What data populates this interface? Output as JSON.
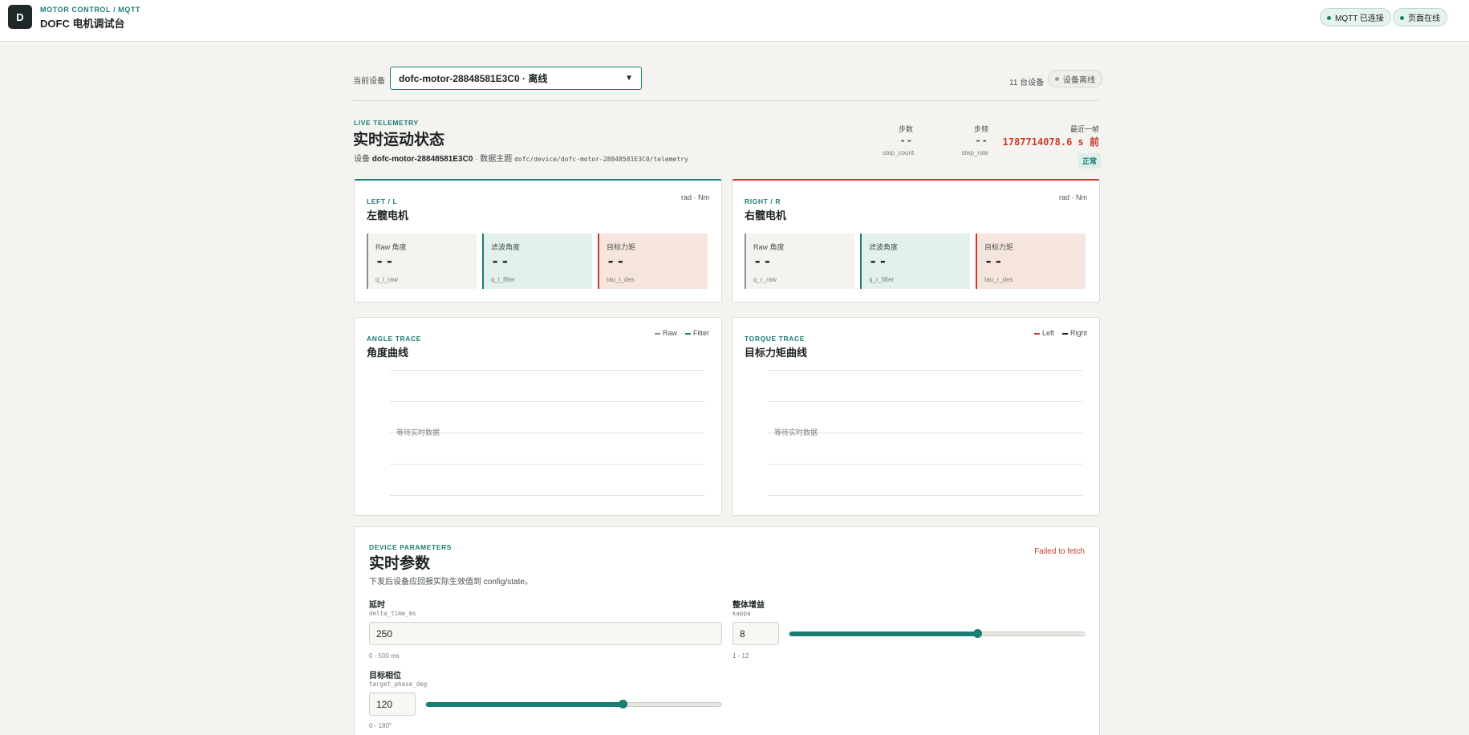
{
  "header": {
    "logo_letter": "D",
    "kicker": "MOTOR CONTROL / MQTT",
    "title": "DOFC 电机调试台",
    "mqtt_status": "MQTT 已连接",
    "page_status": "页面在线"
  },
  "device": {
    "label": "当前设备",
    "selected": "dofc-motor-28848581E3C0 · 离线",
    "count": "11 台设备",
    "state": "设备离线"
  },
  "telemetry": {
    "kicker": "LIVE TELEMETRY",
    "title": "实时运动状态",
    "device_prefix": "设备",
    "device_id": "dofc-motor-28848581E3C0",
    "topic_prefix": "· 数据主题",
    "topic": "dofc/device/dofc-motor-28848581E3C0/telemetry",
    "stats": {
      "steps": {
        "label": "步数",
        "value": "--",
        "key": "step_count"
      },
      "rate": {
        "label": "步频",
        "value": "--",
        "key": "step_rate"
      },
      "last_frame": {
        "label": "最近一帧",
        "value": "1787714078.6 s 前"
      }
    },
    "status": "正常"
  },
  "motors": {
    "left": {
      "kicker": "LEFT / L",
      "title": "左髋电机",
      "unit": "rad · Nm",
      "raw": {
        "label": "Raw 角度",
        "value": "--",
        "key": "q_l_raw"
      },
      "filter": {
        "label": "滤波角度",
        "value": "--",
        "key": "q_l_filter"
      },
      "torque": {
        "label": "目标力矩",
        "value": "--",
        "key": "tau_l_des"
      }
    },
    "right": {
      "kicker": "RIGHT / R",
      "title": "右髋电机",
      "unit": "rad · Nm",
      "raw": {
        "label": "Raw 角度",
        "value": "--",
        "key": "q_r_raw"
      },
      "filter": {
        "label": "滤波角度",
        "value": "--",
        "key": "q_r_filter"
      },
      "torque": {
        "label": "目标力矩",
        "value": "--",
        "key": "tau_r_des"
      }
    }
  },
  "charts": {
    "angle": {
      "kicker": "ANGLE TRACE",
      "title": "角度曲线",
      "legend": [
        "Raw",
        "Filter"
      ],
      "waiting": "等待实时数据"
    },
    "torque": {
      "kicker": "TORQUE TRACE",
      "title": "目标力矩曲线",
      "legend": [
        "Left",
        "Right"
      ],
      "waiting": "等待实时数据"
    }
  },
  "params": {
    "kicker": "DEVICE PARAMETERS",
    "title": "实时参数",
    "description": "下发后设备应回报实际生效值到 config/state。",
    "error": "Failed to fetch",
    "delay": {
      "label": "延时",
      "key": "delta_time_ms",
      "value": "250",
      "range": "0 - 500 ms"
    },
    "kappa": {
      "label": "整体增益",
      "key": "kappa",
      "value": "8",
      "range": "1 - 12",
      "fraction": 0.636
    },
    "phase": {
      "label": "目标相位",
      "key": "target_phase_deg",
      "value": "120",
      "range": "0 - 180°",
      "fraction": 0.667
    }
  },
  "colors": {
    "accent": "#1a7d72",
    "danger": "#c83a2a",
    "background": "#f4f3f0"
  }
}
